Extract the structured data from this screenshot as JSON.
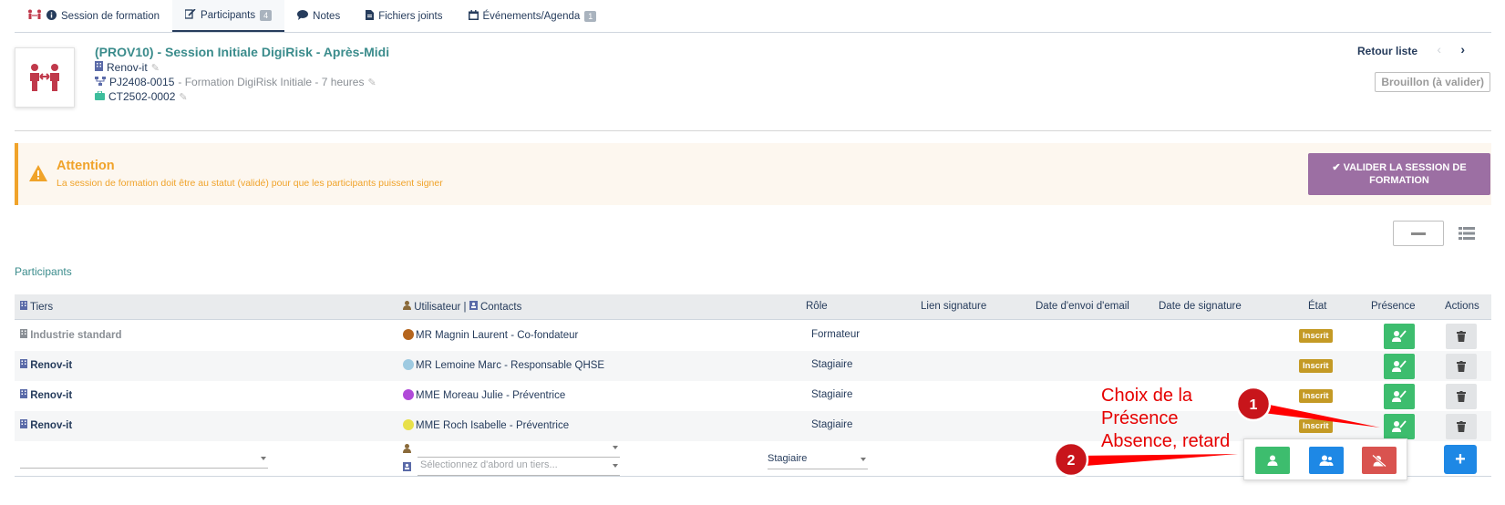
{
  "tabs": [
    {
      "label": "Session de formation",
      "icon": "info-icon",
      "active": false
    },
    {
      "label": "Participants",
      "badge": "4",
      "icon": "signature-icon",
      "active": true
    },
    {
      "label": "Notes",
      "icon": "comment-icon",
      "active": false
    },
    {
      "label": "Fichiers joints",
      "icon": "file-icon",
      "active": false
    },
    {
      "label": "Événements/Agenda",
      "badge": "1",
      "icon": "calendar-icon",
      "active": false
    }
  ],
  "header": {
    "ref_code": "(PROV10)",
    "title_sep": " - ",
    "title": "Session Initiale DigiRisk - Après-Midi",
    "company": "Renov-it",
    "project_ref": "PJ2408-0015",
    "project_desc": " - Formation DigiRisk Initiale - 7 heures",
    "contract_ref": "CT2502-0002",
    "back_label": "Retour liste",
    "status_label": "Brouillon (à valider)"
  },
  "warning": {
    "title": "Attention",
    "text": "La session de formation doit être au statut (validé) pour que les participants puissent signer",
    "button_label": "✔ VALIDER LA SESSION DE FORMATION"
  },
  "section_title": "Participants",
  "table": {
    "headers": {
      "tiers": "Tiers",
      "user": "Utilisateur",
      "sep": " | ",
      "contacts": "Contacts",
      "role": "Rôle",
      "lien": "Lien signature",
      "date_email": "Date d'envoi d'email",
      "date_sig": "Date de signature",
      "etat": "État",
      "presence": "Présence",
      "actions": "Actions"
    },
    "rows": [
      {
        "tiers": "Industrie standard",
        "contact_name": "MR Magnin Laurent",
        "contact_role": " - Co-fondateur",
        "role": "Formateur",
        "etat": "Inscrit",
        "avatar_color": "#b5651d"
      },
      {
        "tiers": "Renov-it",
        "contact_name": "MR Lemoine Marc",
        "contact_role": " - Responsable QHSE",
        "role": "Stagiaire",
        "etat": "Inscrit",
        "avatar_color": "#9ecae1"
      },
      {
        "tiers": "Renov-it",
        "contact_name": "MME Moreau Julie",
        "contact_role": " - Préventrice",
        "role": "Stagiaire",
        "etat": "Inscrit",
        "avatar_color": "#b04ad8"
      },
      {
        "tiers": "Renov-it",
        "contact_name": "MME Roch Isabelle",
        "contact_role": " - Préventrice",
        "role": "Stagiaire",
        "etat": "Inscrit",
        "avatar_color": "#e8e04a"
      }
    ],
    "add_row": {
      "contact_placeholder": "Sélectionnez d'abord un tiers...",
      "role_value": "Stagiaire",
      "add_label": "+"
    }
  },
  "annotations": {
    "line1": "Choix de la",
    "line2": "Présence",
    "line3": "Absence, retard",
    "marker1": "1",
    "marker2": "2"
  },
  "colors": {
    "primary": "#263c5c",
    "teal": "#3b8c8c",
    "warning": "#f0a32a",
    "validate": "#9c6fa3",
    "present": "#3dbd6e",
    "remote": "#1e88e5",
    "absent": "#d9534f",
    "inscrit": "#c49a25",
    "annotation": "#e60000"
  }
}
